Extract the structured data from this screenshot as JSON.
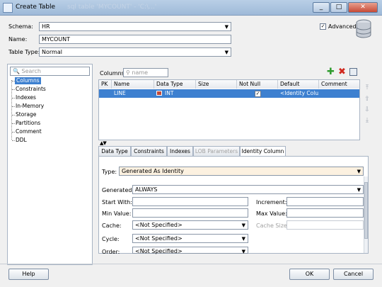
{
  "window": {
    "title": "Create Table",
    "ghost_title": "sql table 'MYCOUNT' - 'C:\\...'"
  },
  "header": {
    "schema_label": "Schema:",
    "schema_value": "HR",
    "name_label": "Name:",
    "name_value": "MYCOUNT",
    "table_type_label": "Table Type:",
    "table_type_value": "Normal",
    "advanced_label": "Advanced",
    "advanced_checked": true
  },
  "sidebar": {
    "search_placeholder": "Search",
    "items": [
      {
        "label": "Columns",
        "selected": true
      },
      {
        "label": "Constraints"
      },
      {
        "label": "Indexes"
      },
      {
        "label": "In-Memory"
      },
      {
        "label": "Storage"
      },
      {
        "label": "Partitions"
      },
      {
        "label": "Comment"
      },
      {
        "label": "DDL"
      }
    ]
  },
  "columns": {
    "label": "Columns:",
    "filter_placeholder": "name",
    "headers": [
      "PK",
      "Name",
      "Data Type",
      "Size",
      "Not Null",
      "Default",
      "Comment"
    ],
    "rows": [
      {
        "pk": "",
        "name": "LINE",
        "data_type": "INT",
        "size": "",
        "not_null": true,
        "default": "<Identity Colu...",
        "comment": ""
      }
    ]
  },
  "tabs": [
    {
      "label": "Data Type"
    },
    {
      "label": "Constraints"
    },
    {
      "label": "Indexes"
    },
    {
      "label": "LOB Parameters",
      "disabled": true
    },
    {
      "label": "Identity Column",
      "active": true
    }
  ],
  "identity": {
    "type_label": "Type:",
    "type_value": "Generated As Identity",
    "generated_label": "Generated:",
    "generated_value": "ALWAYS",
    "start_with_label": "Start With:",
    "start_with_value": "",
    "increment_label": "Increment:",
    "increment_value": "",
    "min_value_label": "Min Value:",
    "min_value_value": "",
    "max_value_label": "Max Value:",
    "max_value_value": "",
    "cache_label": "Cache:",
    "cache_value": "<Not Specified>",
    "cache_size_label": "Cache Size:",
    "cache_size_value": "",
    "cycle_label": "Cycle:",
    "cycle_value": "<Not Specified>",
    "order_label": "Order:",
    "order_value": "<Not Specified>"
  },
  "footer": {
    "help": "Help",
    "ok": "OK",
    "cancel": "Cancel"
  },
  "colors": {
    "selection": "#3d80d0",
    "add_icon": "#2e9b2e",
    "delete_icon": "#d0281e"
  }
}
